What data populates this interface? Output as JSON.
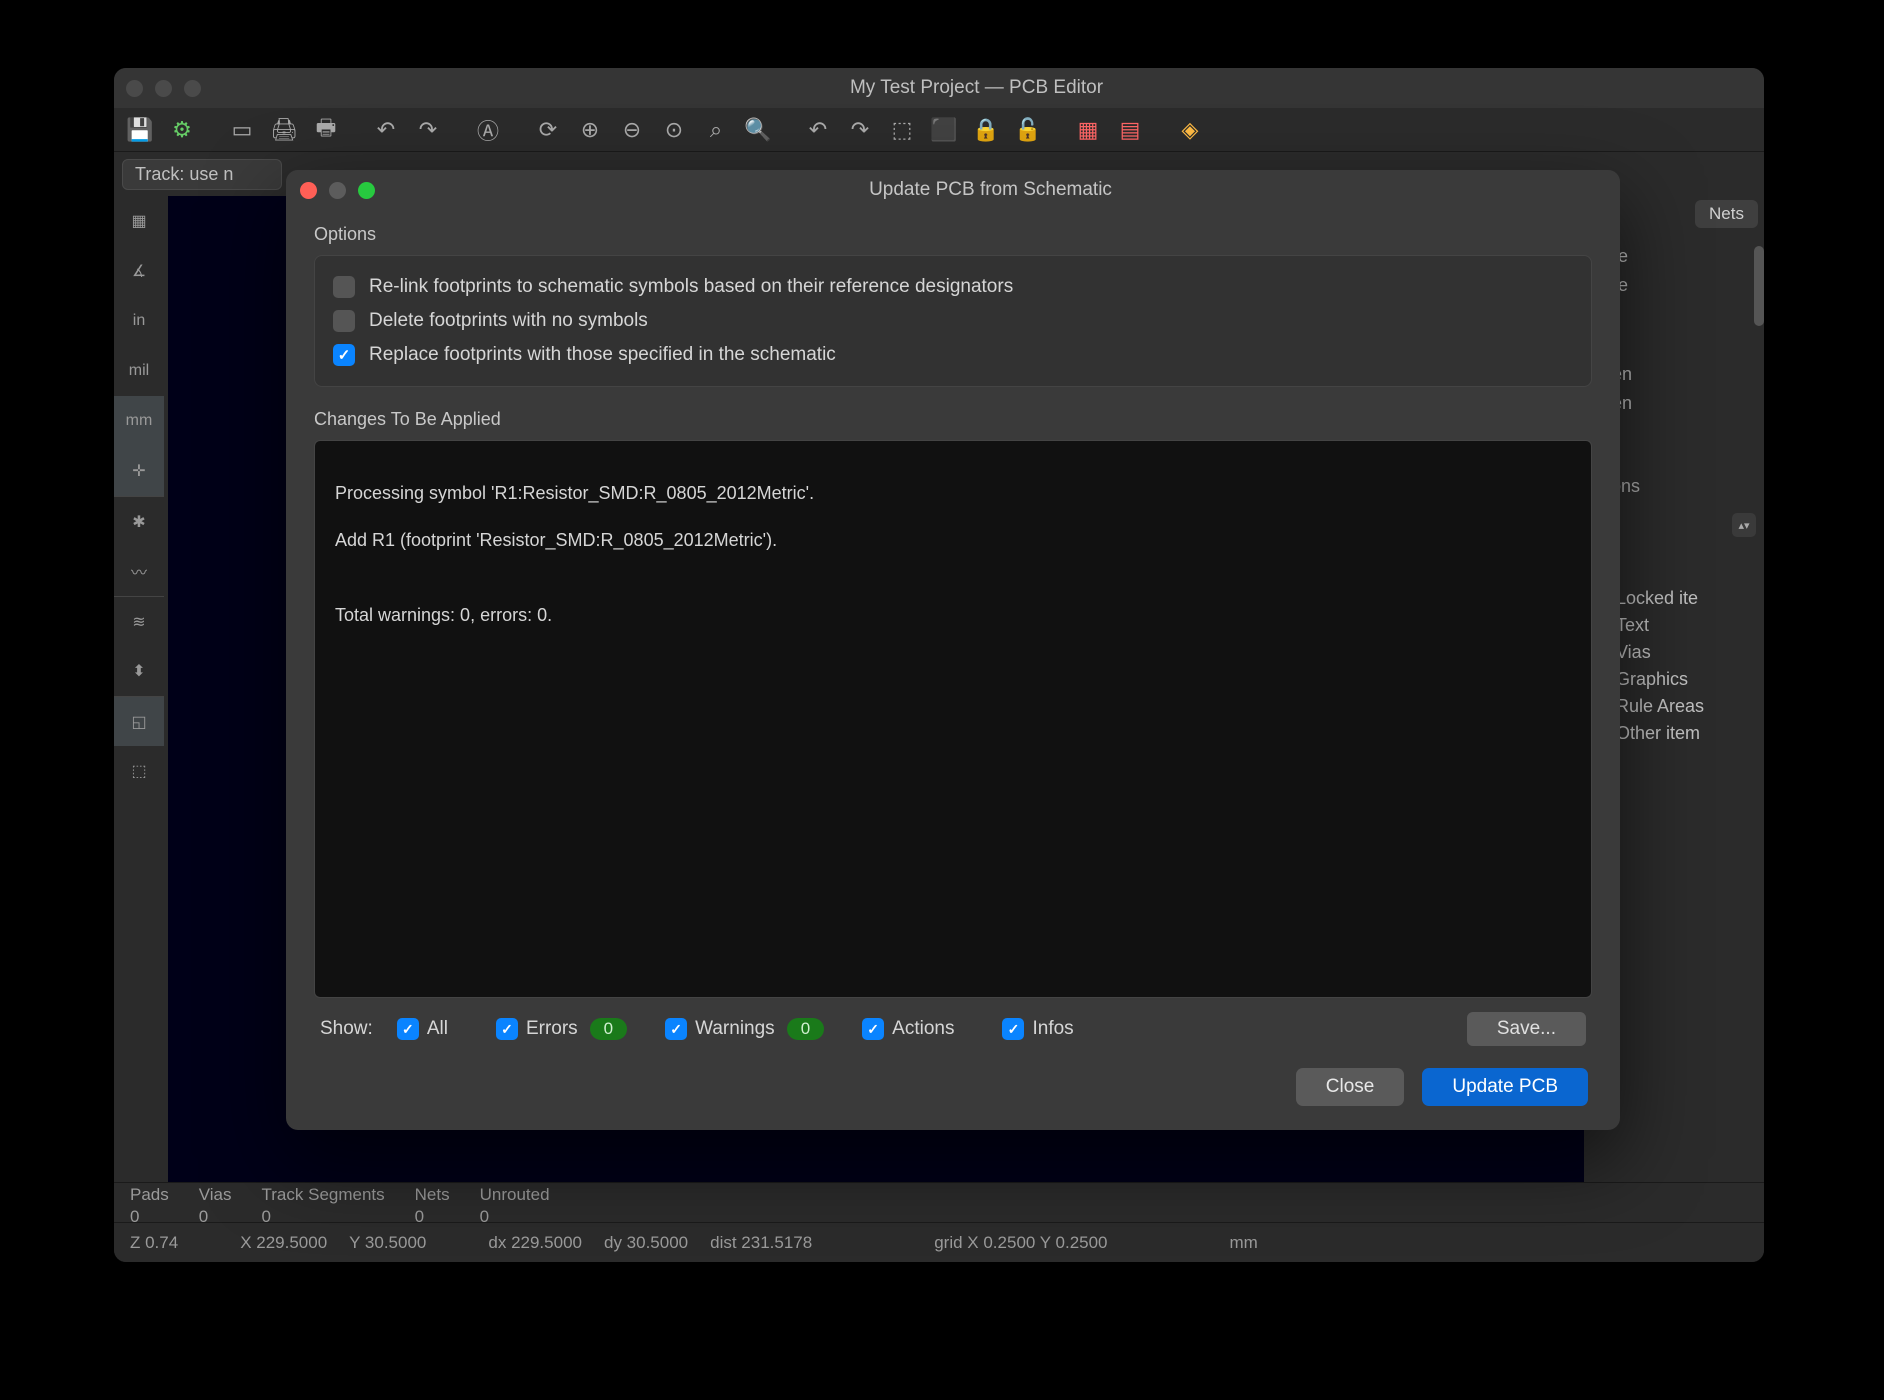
{
  "mainWindow": {
    "title": "My Test Project — PCB Editor",
    "trackCombo": "Track: use n"
  },
  "leftToolbar": {
    "items": [
      "grid",
      "polar",
      "in",
      "mil",
      "mm",
      "cursor",
      "ratsnest",
      "curved",
      "layers",
      "contrast",
      "zone",
      "pad"
    ]
  },
  "rightPanel": {
    "tab": "Nets",
    "items": [
      "sive",
      "sive",
      "reen",
      "reen"
    ],
    "options": "ptions",
    "checks": [
      "Locked ite",
      "Text",
      "Vias",
      "Graphics",
      "Rule Areas",
      "Other item"
    ]
  },
  "status1": {
    "pads": {
      "label": "Pads",
      "value": "0"
    },
    "vias": {
      "label": "Vias",
      "value": "0"
    },
    "tracks": {
      "label": "Track Segments",
      "value": "0"
    },
    "nets": {
      "label": "Nets",
      "value": "0"
    },
    "unrouted": {
      "label": "Unrouted",
      "value": "0"
    }
  },
  "status2": {
    "z": "Z 0.74",
    "x": "X 229.5000",
    "y": "Y 30.5000",
    "dx": "dx 229.5000",
    "dy": "dy 30.5000",
    "dist": "dist 231.5178",
    "grid": "grid X 0.2500  Y 0.2500",
    "unit": "mm"
  },
  "dialog": {
    "title": "Update PCB from Schematic",
    "optionsLabel": "Options",
    "options": [
      {
        "label": "Re-link footprints to schematic symbols based on their reference designators",
        "checked": false
      },
      {
        "label": "Delete footprints with no symbols",
        "checked": false
      },
      {
        "label": "Replace footprints with those specified in the schematic",
        "checked": true
      }
    ],
    "changesLabel": "Changes To Be Applied",
    "log": {
      "line1": "Processing symbol 'R1:Resistor_SMD:R_0805_2012Metric'.",
      "line2": "Add R1 (footprint 'Resistor_SMD:R_0805_2012Metric').",
      "total": "Total warnings: 0, errors: 0."
    },
    "show": {
      "label": "Show:",
      "all": "All",
      "errors": "Errors",
      "errorsCount": "0",
      "warnings": "Warnings",
      "warningsCount": "0",
      "actions": "Actions",
      "infos": "Infos",
      "save": "Save..."
    },
    "close": "Close",
    "update": "Update PCB"
  }
}
